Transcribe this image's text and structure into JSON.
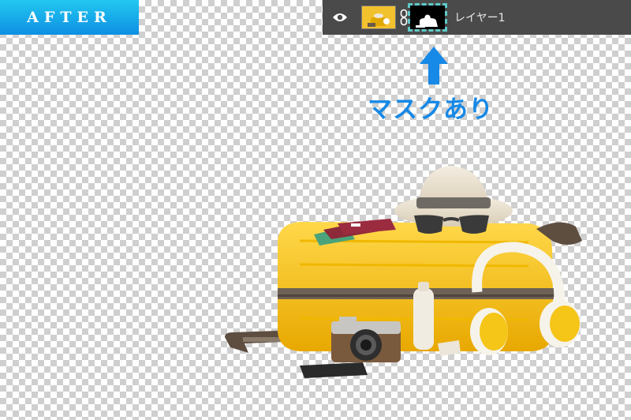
{
  "badge": {
    "label": "AFTER"
  },
  "layers_panel": {
    "layer_name": "レイヤー1",
    "icons": [
      "eye-icon",
      "layer-thumbnail",
      "chain-link-icon",
      "mask-thumbnail"
    ]
  },
  "annotation": {
    "text": "マスクあり",
    "arrow_icon": "up-arrow-icon"
  },
  "colors": {
    "accent": "#1789e6",
    "badge_top": "#22c8f0",
    "badge_bottom": "#0e8fe3",
    "panel_bg": "#4a4a4a",
    "mask_border": "#5fc9c9",
    "suitcase": "#f5c518"
  }
}
